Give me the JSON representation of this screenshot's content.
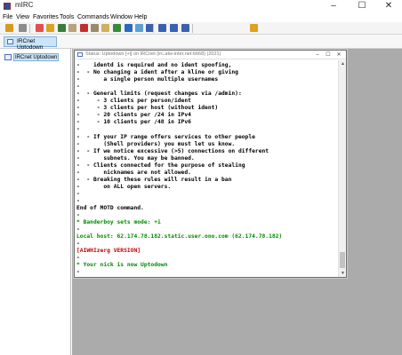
{
  "app": {
    "title": "mIRC",
    "window_controls": {
      "minimize": "–",
      "maximize": "☐",
      "close": "✕"
    }
  },
  "menubar": {
    "items": [
      "File",
      "View",
      "Favorites",
      "Tools",
      "Commands",
      "Window",
      "Help"
    ]
  },
  "toolbar": {
    "buttons": [
      {
        "icon": "connect-icon",
        "color": "#d99a1e"
      },
      {
        "icon": "options-icon",
        "color": "#8c8c8c"
      },
      {
        "icon": "channel-list-icon",
        "color": "#e35050"
      },
      {
        "icon": "favorites-icon",
        "color": "#e0a020"
      },
      {
        "icon": "address-book-icon",
        "color": "#3a7d3a"
      },
      {
        "icon": "scripts-editor-icon",
        "color": "#b8a37a"
      },
      {
        "icon": "remote-icon",
        "color": "#c03030"
      },
      {
        "icon": "log-icon",
        "color": "#9a8a6a"
      },
      {
        "icon": "notify-icon",
        "color": "#d0b060"
      },
      {
        "icon": "dcc-send-icon",
        "color": "#3a8a3a"
      },
      {
        "icon": "dcc-chat-icon",
        "color": "#2a6ac0"
      },
      {
        "icon": "dcc-get-icon",
        "color": "#5aa0d0"
      },
      {
        "icon": "cascade-icon",
        "color": "#3a60b0"
      },
      {
        "icon": "tile-horizontal-icon",
        "color": "#3a60b0"
      },
      {
        "icon": "tile-vertical-icon",
        "color": "#3a60b0"
      },
      {
        "icon": "arrange-icon",
        "color": "#3a60b0"
      },
      {
        "icon": "help-icon",
        "color": "#e0a020"
      }
    ]
  },
  "switchbar": {
    "label": "IRCnet Uptodown"
  },
  "treebar": {
    "items": [
      {
        "label": "IRCnet Uptodown"
      }
    ]
  },
  "status_window": {
    "title": "Status: Uptodown [+i] on IRCnet (irc.atw-inter.net:6668) (2021)",
    "lines": [
      {
        "text": "-    identd is required and no ident spoofing,",
        "color": "black"
      },
      {
        "text": "-  - No changing a ident after a kline or giving",
        "color": "black"
      },
      {
        "text": "-       a single person multiple usernames",
        "color": "black"
      },
      {
        "text": "-",
        "color": "black"
      },
      {
        "text": "-  - General limits (request changes via /admin):",
        "color": "black"
      },
      {
        "text": "-     - 3 clients per person/ident",
        "color": "black"
      },
      {
        "text": "-     - 3 clients per host (without ident)",
        "color": "black"
      },
      {
        "text": "-     - 20 clients per /24 in IPv4",
        "color": "black"
      },
      {
        "text": "-     - 10 clients per /48 in IPv6",
        "color": "black"
      },
      {
        "text": "-",
        "color": "black"
      },
      {
        "text": "-  - If your IP range offers services to other people",
        "color": "black"
      },
      {
        "text": "-       (Shell providers) you must let us know.",
        "color": "black"
      },
      {
        "text": "-  - If we notice excessive (>5) connections on different",
        "color": "black"
      },
      {
        "text": "-       subnets. You may be banned.",
        "color": "black"
      },
      {
        "text": "-  - Clients connected for the purpose of stealing",
        "color": "black"
      },
      {
        "text": "-       nicknames are not allowed.",
        "color": "black"
      },
      {
        "text": "-  - Breaking these rules will result in a ban",
        "color": "black"
      },
      {
        "text": "-       on ALL open servers.",
        "color": "black"
      },
      {
        "text": "-",
        "color": "black"
      },
      {
        "text": "-",
        "color": "black"
      },
      {
        "text": "End of MOTD command.",
        "color": "black"
      },
      {
        "text": "-",
        "color": "black"
      },
      {
        "text": "* Banderboy sets mode: +i",
        "color": "green"
      },
      {
        "text": "-",
        "color": "black"
      },
      {
        "text": "Local host: 62.174.78.182.static.user.ono.com (62.174.78.182)",
        "color": "green"
      },
      {
        "text": "-",
        "color": "black"
      },
      {
        "text": "[AIWHIzerg VERSION]",
        "color": "red"
      },
      {
        "text": "-",
        "color": "black"
      },
      {
        "text": "* Your nick is now Uptodown",
        "color": "green"
      },
      {
        "text": "-",
        "color": "black"
      }
    ]
  }
}
